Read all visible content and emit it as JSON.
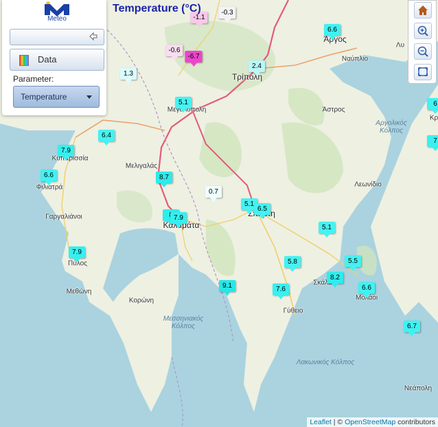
{
  "title": "Temperature (°C)",
  "panel": {
    "logo_text": "Meteo",
    "data_label": "Data",
    "parameter_label": "Parameter:",
    "parameter_value": "Temperature"
  },
  "map_controls": [
    "home-icon",
    "zoom-in-icon",
    "zoom-out-icon",
    "fullscreen-icon"
  ],
  "attribution": {
    "leaflet": "Leaflet",
    "separator": " | © ",
    "osm": "OpenStreetMap",
    "suffix": " contributors"
  },
  "places": [
    {
      "id": "argos",
      "name": "Άργος"
    },
    {
      "id": "nafplio",
      "name": "Ναύπλιο"
    },
    {
      "id": "tripoli",
      "name": "Τρίπολη"
    },
    {
      "id": "astros",
      "name": "Άστρος"
    },
    {
      "id": "megalopoli",
      "name": "Μεγαλόπολη"
    },
    {
      "id": "kyparissia",
      "name": "Κυπαρισσία"
    },
    {
      "id": "meligalas",
      "name": "Μελιγαλάς"
    },
    {
      "id": "filiatra",
      "name": "Φιλιατρά"
    },
    {
      "id": "gargalianoi",
      "name": "Γαργαλιάνοι"
    },
    {
      "id": "kalamata",
      "name": "Καλαμάτα"
    },
    {
      "id": "sparti",
      "name": "Σπάρτη"
    },
    {
      "id": "leonidio",
      "name": "Λεωνίδιο"
    },
    {
      "id": "pylos",
      "name": "Πύλος"
    },
    {
      "id": "methoni",
      "name": "Μεθώνη"
    },
    {
      "id": "koroni",
      "name": "Κορώνη"
    },
    {
      "id": "skala",
      "name": "Σκάλα"
    },
    {
      "id": "molaoi",
      "name": "Μολάοι"
    },
    {
      "id": "gytheio",
      "name": "Γύθειο"
    },
    {
      "id": "neapoli",
      "name": "Νεάπολη"
    },
    {
      "id": "messiniakos",
      "name": "Μεσσηνιακός Κόλπος"
    },
    {
      "id": "lakonikos",
      "name": "Λακωνικός Κόλπος"
    },
    {
      "id": "argolikos",
      "name": "Αργολικός Κόλπος"
    },
    {
      "id": "kr",
      "name": "Κρ"
    },
    {
      "id": "lu",
      "name": "Λυ"
    }
  ],
  "stations": [
    {
      "value": "-1.1",
      "color": "#f7c9e8"
    },
    {
      "value": "-0.3",
      "color": "#f4f4f4"
    },
    {
      "value": "6.6",
      "color": "#3ff2f2"
    },
    {
      "value": "-0.6",
      "color": "#f9dcef"
    },
    {
      "value": "-6.7",
      "color": "#ee44cc"
    },
    {
      "value": "1.3",
      "color": "#dafcfc"
    },
    {
      "value": "2.4",
      "color": "#b9f7f7"
    },
    {
      "value": "5.1",
      "color": "#46f2f2"
    },
    {
      "value": "6.4",
      "color": "#44f2f2"
    },
    {
      "value": "7.9",
      "color": "#36efef"
    },
    {
      "value": "6.6",
      "color": "#3ff2f2"
    },
    {
      "value": "8.7",
      "color": "#2eeaea"
    },
    {
      "value": "0.7",
      "color": "#eefefe"
    },
    {
      "value": "5.1",
      "color": "#46f2f2"
    },
    {
      "value": "6.5",
      "color": "#40f2f2"
    },
    {
      "value": "8",
      "color": "#30ecec"
    },
    {
      "value": "7.9",
      "color": "#36efef"
    },
    {
      "value": "5.1",
      "color": "#46f2f2"
    },
    {
      "value": "7.9",
      "color": "#36efef"
    },
    {
      "value": "5.8",
      "color": "#44f2f2"
    },
    {
      "value": "5.5",
      "color": "#44f2f2"
    },
    {
      "value": "8.2",
      "color": "#30ecec"
    },
    {
      "value": "9.1",
      "color": "#28e6e6"
    },
    {
      "value": "7.6",
      "color": "#38f0f0"
    },
    {
      "value": "6.6",
      "color": "#3ff2f2"
    },
    {
      "value": "6.7",
      "color": "#3ef2f2"
    },
    {
      "value": "6",
      "color": "#40f2f2"
    },
    {
      "value": "7",
      "color": "#3af0f0"
    }
  ]
}
